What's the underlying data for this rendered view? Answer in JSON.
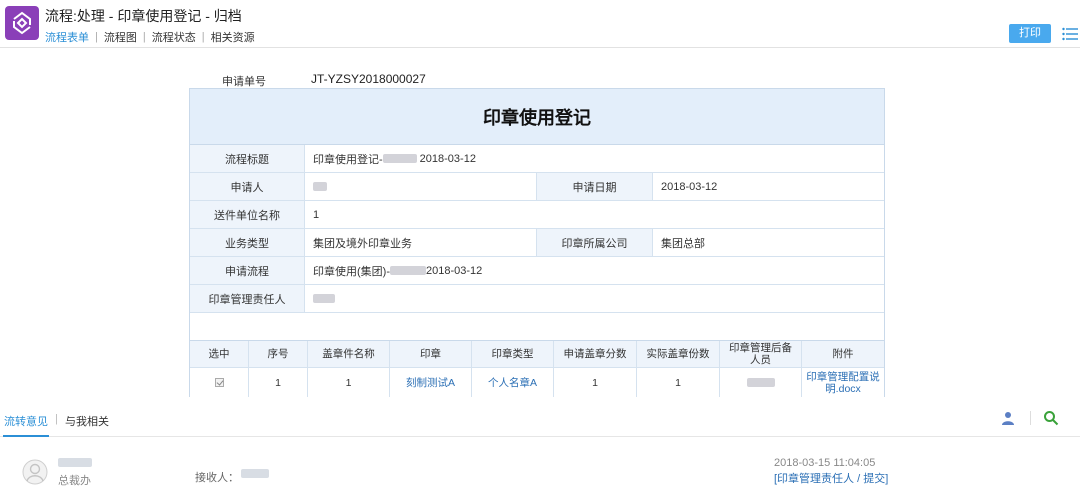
{
  "header": {
    "title": "流程:处理 - 印章使用登记 - 归档",
    "tabs": [
      "流程表单",
      "流程图",
      "流程状态",
      "相关资源"
    ],
    "print_label": "打印"
  },
  "application_no": {
    "label": "申请单号",
    "value": "JT-YZSY2018000027"
  },
  "form": {
    "title": "印章使用登记",
    "process_title_label": "流程标题",
    "process_title_prefix": "印章使用登记-",
    "process_title_date": "2018-03-12",
    "applicant_label": "申请人",
    "apply_date_label": "申请日期",
    "apply_date": "2018-03-12",
    "recipient_count_label": "送件单位名称",
    "recipient_count": "1",
    "business_type_label": "业务类型",
    "business_type": "集团及境外印章业务",
    "seal_company_label": "印章所属公司",
    "seal_company": "集团总部",
    "apply_process_label": "申请流程",
    "apply_process_prefix": "印章使用(集团)-",
    "apply_process_date": "2018-03-12",
    "seal_manager_label": "印章管理责任人"
  },
  "detail_table": {
    "headers": [
      "选中",
      "序号",
      "盖章件名称",
      "印章",
      "印章类型",
      "申请盖章分数",
      "实际盖章份数",
      "印章管理后备人员",
      "附件"
    ],
    "row": {
      "index": "1",
      "doc_name": "1",
      "seal": "刻制测试A",
      "seal_type": "个人名章A",
      "requested_copies": "1",
      "actual_copies": "1",
      "attachment": "印章管理配置说明.docx"
    }
  },
  "bottom": {
    "tabs": [
      "流转意见",
      "与我相关"
    ],
    "comment": {
      "dept": "总裁办",
      "receiver_label": "接收人：",
      "time": "2018-03-15  11:04:05",
      "action": "[印章管理责任人 / 提交]"
    }
  },
  "colors": {
    "accent": "#2b8fd6",
    "logo": "#8a3fb8",
    "print_button": "#49a9ee",
    "header_fill": "#e3eefa"
  }
}
